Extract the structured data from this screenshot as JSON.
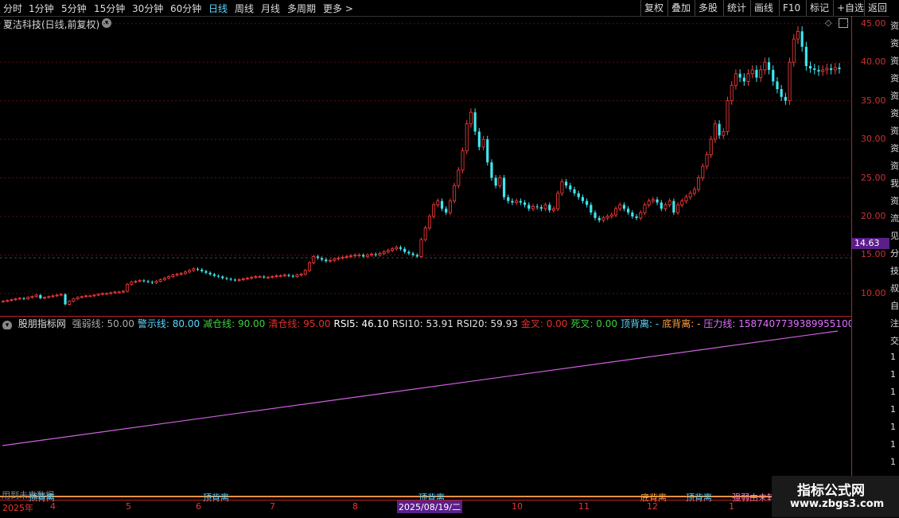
{
  "toolbar": {
    "periods": [
      "分时",
      "1分钟",
      "5分钟",
      "15分钟",
      "30分钟",
      "60分钟",
      "日线",
      "周线",
      "月线",
      "多周期",
      "更多 >"
    ],
    "active": "日线",
    "right": [
      "复权",
      "叠加",
      "多股",
      "统计",
      "画线",
      "F10",
      "标记",
      "+自选",
      "返回"
    ]
  },
  "chart_title": "夏洁科技(日线,前复权)",
  "price_axis": [
    "45.00",
    "40.00",
    "35.00",
    "30.00",
    "25.00",
    "20.00",
    "15.00",
    "10.00"
  ],
  "current_price": "14.63",
  "indicator": {
    "name": "股朋指标网",
    "fields": [
      {
        "label": "强弱线: 50.00",
        "color": "#aaaaaa"
      },
      {
        "label": "警示线: 80.00",
        "color": "#5bd8ff"
      },
      {
        "label": "减仓线: 90.00",
        "color": "#3fcf3f"
      },
      {
        "label": "清仓线: 95.00",
        "color": "#e03030"
      },
      {
        "label": "RSI5: 46.10",
        "color": "#ffffff"
      },
      {
        "label": "RSI10: 53.91",
        "color": "#e0e0e0"
      },
      {
        "label": "RSI20: 59.93",
        "color": "#e0e0e0"
      },
      {
        "label": "金叉: 0.00",
        "color": "#e03030"
      },
      {
        "label": "死叉: 0.00",
        "color": "#3fcf3f"
      },
      {
        "label": "顶背离: -",
        "color": "#5bd8ff"
      },
      {
        "label": "底背离: -",
        "color": "#ffa040"
      },
      {
        "label": "压力线: 158740773938995510000000000",
        "color": "#e070ff"
      }
    ]
  },
  "signals": [
    {
      "text": "顶背离",
      "color": "#5bd8ff"
    },
    {
      "text": "顶背离",
      "color": "#5bd8ff"
    },
    {
      "text": "顶背离",
      "color": "#5bd8ff"
    },
    {
      "text": "底背离",
      "color": "#ffa040"
    },
    {
      "text": "顶背离",
      "color": "#5bd8ff"
    },
    {
      "text": "强弱由未转",
      "color": "#ff80c0"
    }
  ],
  "watermark_note": "用到未来数据",
  "dates": [
    "2025年",
    "4",
    "5",
    "6",
    "7",
    "8",
    "10",
    "11",
    "12",
    "1"
  ],
  "highlight_date": "2025/08/19/二",
  "right_strip_chars": [
    "资",
    "资",
    "资",
    "资",
    "资",
    "资",
    "资",
    "资",
    "资",
    "我",
    "资",
    "流",
    "见",
    "分",
    "技",
    "叔",
    "自",
    "注",
    "交",
    "1",
    "1",
    "1",
    "1",
    "1",
    "1",
    "1",
    "1"
  ],
  "site": {
    "title": "指标公式网",
    "url": "www.zbgs3.com"
  },
  "candles_hint": "series",
  "chart_data": {
    "type": "candlestick",
    "ylim": [
      7,
      46
    ],
    "close": [
      9.0,
      9.1,
      9.2,
      9.3,
      9.4,
      9.3,
      9.5,
      9.6,
      9.8,
      9.4,
      9.5,
      9.6,
      9.7,
      9.8,
      9.9,
      8.6,
      9.0,
      9.3,
      9.5,
      9.6,
      9.7,
      9.7,
      9.8,
      9.9,
      10.0,
      10.0,
      10.1,
      10.2,
      10.2,
      10.3,
      11.2,
      11.5,
      11.6,
      11.7,
      11.6,
      11.5,
      11.4,
      11.6,
      11.8,
      12.0,
      12.2,
      12.4,
      12.5,
      12.6,
      12.8,
      13.0,
      13.2,
      13.1,
      12.9,
      12.7,
      12.5,
      12.3,
      12.2,
      12.0,
      11.9,
      11.8,
      11.7,
      11.8,
      11.9,
      12.0,
      12.1,
      12.2,
      12.2,
      12.1,
      12.1,
      12.2,
      12.3,
      12.3,
      12.4,
      12.3,
      12.2,
      12.4,
      12.5,
      13.0,
      14.0,
      14.8,
      14.6,
      14.4,
      14.2,
      14.3,
      14.5,
      14.6,
      14.7,
      14.8,
      14.9,
      15.0,
      15.0,
      14.8,
      15.0,
      15.1,
      15.0,
      15.2,
      15.4,
      15.6,
      15.8,
      16.0,
      15.8,
      15.4,
      15.2,
      15.0,
      14.8,
      17.0,
      18.5,
      20.0,
      21.5,
      22.0,
      21.0,
      20.5,
      22.0,
      24.0,
      26.0,
      28.5,
      32.0,
      33.5,
      31.0,
      29.0,
      30.0,
      27.0,
      25.0,
      24.0,
      25.0,
      22.5,
      22.0,
      21.8,
      22.0,
      21.8,
      21.5,
      21.0,
      21.3,
      21.2,
      21.0,
      21.5,
      20.8,
      21.0,
      23.0,
      24.5,
      24.0,
      23.5,
      23.0,
      22.5,
      22.0,
      21.5,
      20.5,
      19.8,
      19.5,
      19.8,
      20.0,
      20.2,
      21.0,
      21.5,
      21.0,
      20.5,
      20.0,
      19.8,
      20.5,
      21.5,
      22.0,
      22.2,
      21.8,
      21.0,
      21.5,
      22.0,
      20.5,
      21.5,
      22.0,
      22.5,
      23.0,
      23.5,
      25.0,
      26.5,
      28.0,
      30.0,
      32.0,
      30.5,
      31.0,
      35.0,
      37.0,
      38.5,
      38.0,
      37.5,
      38.5,
      39.0,
      38.0,
      39.0,
      40.0,
      39.0,
      37.5,
      36.5,
      35.5,
      35.0,
      40.0,
      43.0,
      44.0,
      42.0,
      39.5,
      39.2,
      39.0,
      38.8,
      39.0,
      39.2,
      39.0,
      39.3,
      39.1
    ]
  }
}
